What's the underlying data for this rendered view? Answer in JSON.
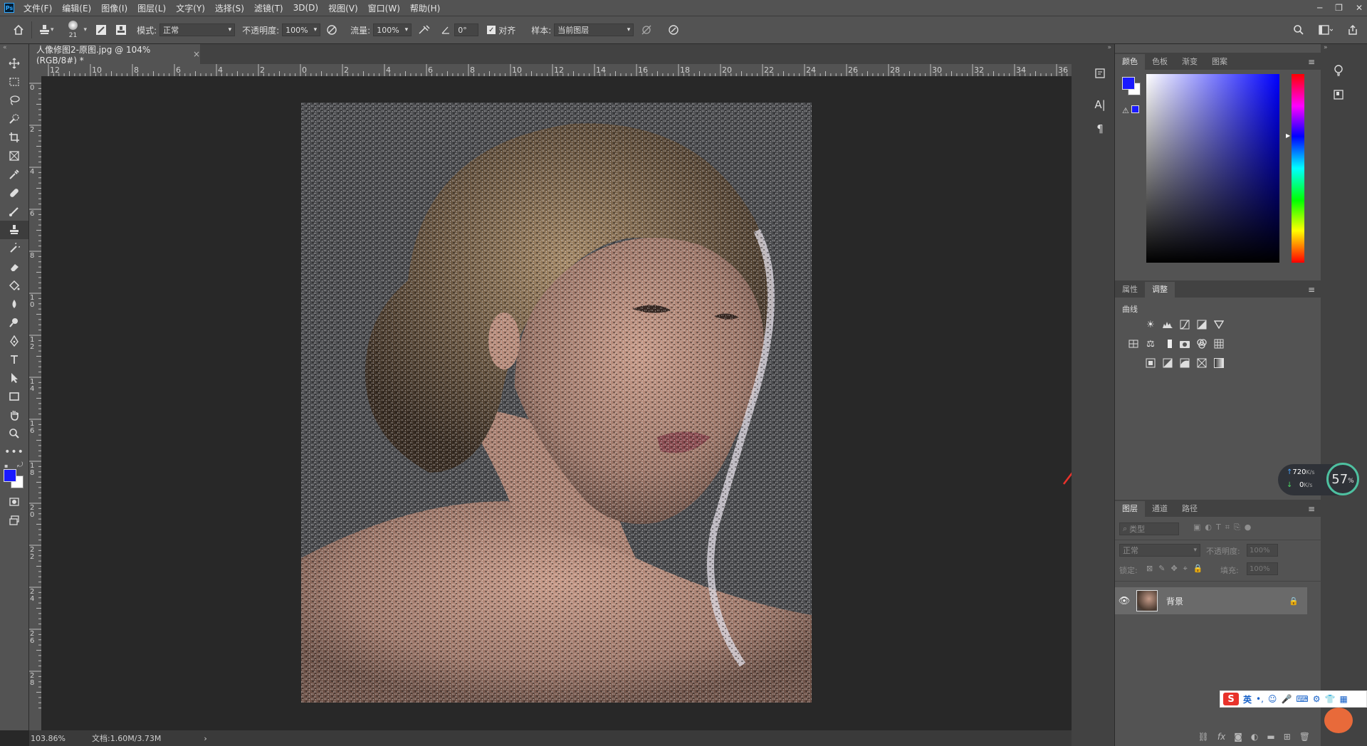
{
  "app": {
    "logo": "Ps"
  },
  "menu": [
    "文件(F)",
    "编辑(E)",
    "图像(I)",
    "图层(L)",
    "文字(Y)",
    "选择(S)",
    "滤镜(T)",
    "3D(D)",
    "视图(V)",
    "窗口(W)",
    "帮助(H)"
  ],
  "window_controls": {
    "minimize": "─",
    "restore": "❐",
    "close": "✕"
  },
  "options_bar": {
    "brush_size": "21",
    "mode_label": "模式:",
    "mode_value": "正常",
    "opacity_label": "不透明度:",
    "opacity_value": "100%",
    "flow_label": "流量:",
    "flow_value": "100%",
    "angle_value": "0°",
    "align_label": "对齐",
    "sample_label": "样本:",
    "sample_value": "当前图层"
  },
  "document": {
    "tab_title": "人像修图2-原图.jpg @ 104%(RGB/8#) *",
    "close_glyph": "×",
    "zoom": "103.86%",
    "doc_info": "文档:1.60M/3.73M",
    "status_arrow": "›"
  },
  "ruler": {
    "h_labels": [
      "12",
      "10",
      "8",
      "6",
      "4",
      "2",
      "0",
      "2",
      "4",
      "6",
      "8",
      "10",
      "12",
      "14",
      "16",
      "18",
      "20",
      "22",
      "24",
      "26",
      "28",
      "30",
      "32",
      "34",
      "36"
    ],
    "v_labels": [
      "0",
      "2",
      "4",
      "6",
      "8",
      "10",
      "12",
      "14",
      "16",
      "18",
      "20",
      "22",
      "24",
      "26",
      "28"
    ]
  },
  "color_panel": {
    "tabs": [
      "颜色",
      "色板",
      "渐变",
      "图案"
    ],
    "foreground": "#1a1aff",
    "background": "#ffffff",
    "picker_hue": "#0000ff"
  },
  "adjust_panel": {
    "tabs": [
      "属性",
      "调整"
    ],
    "current": "曲线"
  },
  "layers_panel": {
    "tabs": [
      "图层",
      "通道",
      "路径"
    ],
    "filter_placeholder": "类型",
    "blend_mode": "正常",
    "opacity_label": "不透明度:",
    "opacity_value": "100%",
    "lock_label": "锁定:",
    "fill_label": "填充:",
    "fill_value": "100%",
    "layers": [
      {
        "name": "背景",
        "visible": true,
        "locked": true
      }
    ]
  },
  "net_widget": {
    "up": "720",
    "up_unit": "K/s",
    "down": "0",
    "down_unit": "K/s",
    "percent": "57",
    "percent_unit": "%"
  },
  "ime_bar": {
    "logo": "S",
    "lang": "英"
  },
  "colors": {
    "ui_dark": "#535353",
    "canvas_bg": "#282828",
    "panel_header": "#424242",
    "arrow_red": "#e8322b",
    "accent_blue": "#31a8ff"
  }
}
